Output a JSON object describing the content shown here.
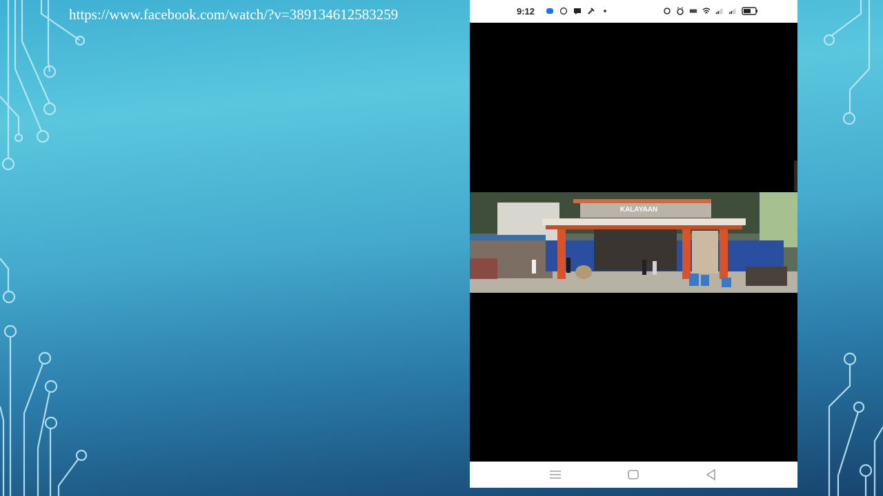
{
  "slide": {
    "url_text": "https://www.facebook.com/watch/?v=389134612583259"
  },
  "phone": {
    "status_bar": {
      "time": "9:12"
    },
    "video": {
      "signboard_text": "KALAYAAN"
    },
    "nav_bar": {
      "menu_icon": "menu-icon",
      "home_icon": "home-icon",
      "back_icon": "back-icon"
    }
  }
}
